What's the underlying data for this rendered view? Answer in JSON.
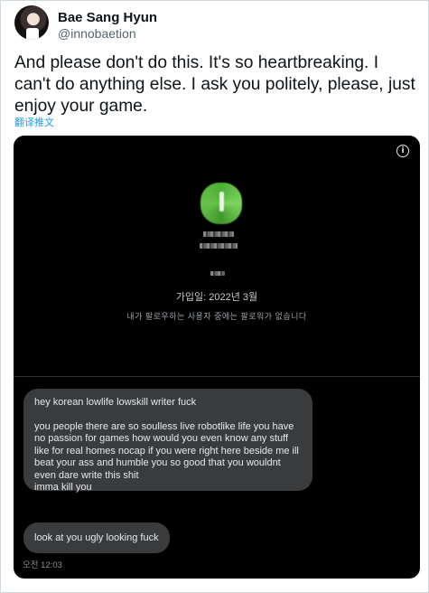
{
  "author": {
    "display_name": "Bae Sang Hyun",
    "handle": "@innobaetion"
  },
  "tweet": {
    "text": "And please don't do this. It's so heartbreaking. I can't do anything else. I ask you politely, please, just enjoy your game.",
    "translate_label": "翻译推文"
  },
  "media": {
    "info_icon": "info-icon",
    "profile": {
      "joined": "가입일: 2022년 3월",
      "no_followers": "내가 팔로우하는 사용자 중에는 팔로워가 없습니다"
    },
    "messages": {
      "first": {
        "line1": "hey korean lowlife lowskill writer fuck",
        "line2": "you people there are so soulless live robotlike life you have no passion for games how would you even know any stuff like for real homes nocap if you were right here beside me ill beat your ass and humble you so good that you wouldnt even dare write this shit",
        "line3": "imma kill you"
      },
      "second": "look at you ugly looking fuck",
      "timestamp": "오전 12:03"
    }
  },
  "colors": {
    "accent": "#1d9bf0",
    "media_bg": "#000000",
    "bubble_bg": "#3a3b3d"
  }
}
